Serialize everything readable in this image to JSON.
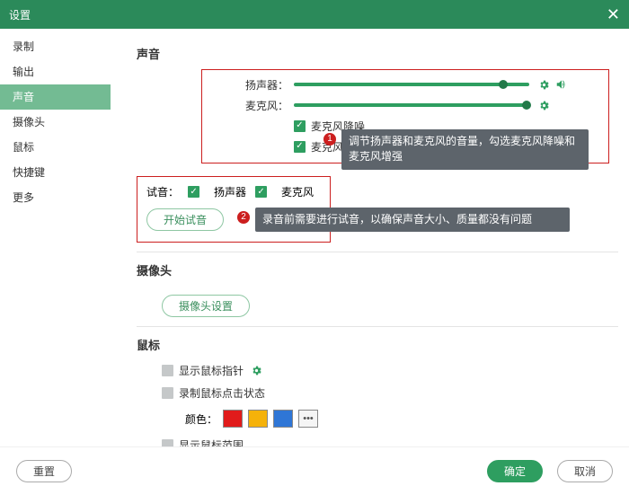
{
  "title": "设置",
  "sidebar": {
    "items": [
      {
        "label": "录制"
      },
      {
        "label": "输出"
      },
      {
        "label": "声音"
      },
      {
        "label": "摄像头"
      },
      {
        "label": "鼠标"
      },
      {
        "label": "快捷键"
      },
      {
        "label": "更多"
      }
    ],
    "active_index": 2
  },
  "sound": {
    "section_title": "声音",
    "speaker_label": "扬声器：",
    "speaker_value": 89,
    "mic_label": "麦克风：",
    "mic_value": 99,
    "noise_label": "麦克风降噪",
    "enhance_label": "麦克风增强",
    "test_label": "试音：",
    "test_speaker": "扬声器",
    "test_mic": "麦克风",
    "start_test_btn": "开始试音"
  },
  "camera": {
    "title": "摄像头",
    "settings_btn": "摄像头设置"
  },
  "mouse": {
    "title": "鼠标",
    "show_pointer": "显示鼠标指针",
    "record_click": "录制鼠标点击状态",
    "color_label": "颜色：",
    "show_range": "显示鼠标范围"
  },
  "callouts": {
    "c1": "调节扬声器和麦克风的音量，勾选麦克风降噪和麦克风增强",
    "c2": "录音前需要进行试音，以确保声音大小、质量都没有问题"
  },
  "footer": {
    "reset": "重置",
    "ok": "确定",
    "cancel": "取消"
  }
}
